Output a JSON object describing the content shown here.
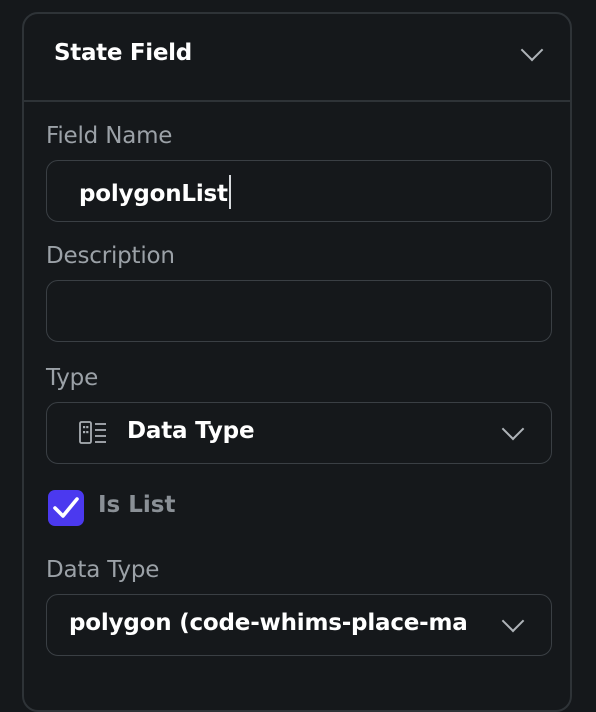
{
  "panel": {
    "title": "State Field"
  },
  "field_name": {
    "label": "Field Name",
    "value": "polygonList"
  },
  "description": {
    "label": "Description",
    "value": ""
  },
  "type": {
    "label": "Type",
    "value": "Data Type",
    "icon": "data-type-icon"
  },
  "is_list": {
    "label": "Is List",
    "checked": true,
    "accent_color": "#4b39ef"
  },
  "data_type": {
    "label": "Data Type",
    "value": "polygon (code-whims-place-ma"
  }
}
